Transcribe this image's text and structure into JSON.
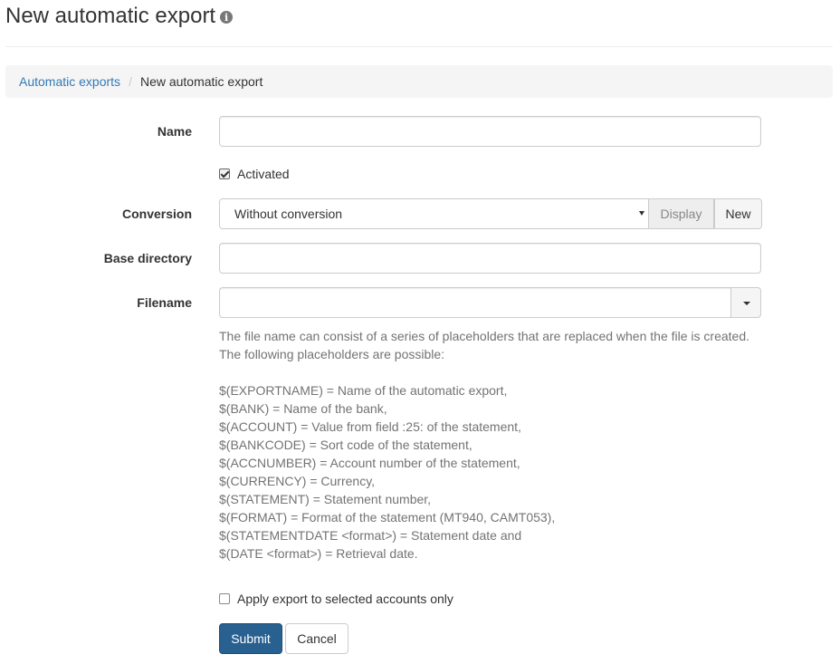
{
  "header": {
    "title": "New automatic export",
    "info_icon": "info-icon"
  },
  "breadcrumb": {
    "parent": "Automatic exports",
    "separator": "/",
    "current": "New automatic export"
  },
  "form": {
    "name": {
      "label": "Name",
      "value": ""
    },
    "activated": {
      "label": "Activated",
      "checked": true
    },
    "conversion": {
      "label": "Conversion",
      "selected": "Without conversion",
      "display_label": "Display",
      "new_label": "New"
    },
    "base_directory": {
      "label": "Base directory",
      "value": ""
    },
    "filename": {
      "label": "Filename",
      "value": ""
    },
    "help": {
      "intro": [
        "The file name can consist of a series of placeholders that are replaced when the file is created.",
        "The following placeholders are possible:"
      ],
      "placeholders": [
        "$(EXPORTNAME) = Name of the automatic export,",
        "$(BANK) = Name of the bank,",
        "$(ACCOUNT) = Value from field :25: of the statement,",
        "$(BANKCODE) = Sort code of the statement,",
        "$(ACCNUMBER) = Account number of the statement,",
        "$(CURRENCY) = Currency,",
        "$(STATEMENT) = Statement number,",
        "$(FORMAT) = Format of the statement (MT940, CAMT053),",
        "$(STATEMENTDATE <format>) = Statement date and",
        "$(DATE <format>) = Retrieval date."
      ]
    },
    "selected_accounts_only": {
      "label": "Apply export to selected accounts only",
      "checked": false
    },
    "submit_label": "Submit",
    "cancel_label": "Cancel"
  }
}
